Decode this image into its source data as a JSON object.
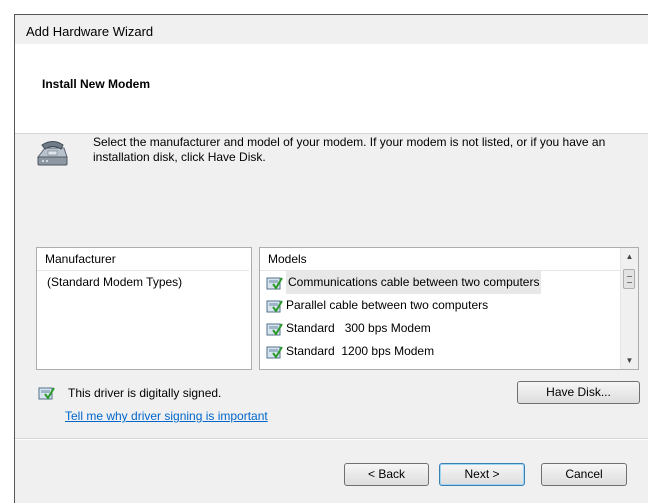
{
  "window": {
    "title": "Add Hardware Wizard"
  },
  "header": {
    "title": "Install New Modem"
  },
  "description": "Select the manufacturer and model of your modem. If your modem is not listed, or if you have an installation disk, click Have Disk.",
  "manufacturer_list": {
    "header": "Manufacturer",
    "items": [
      "(Standard Modem Types)"
    ]
  },
  "models_list": {
    "header": "Models",
    "items": [
      "Communications cable between two computers",
      "Parallel cable between two computers",
      "Standard   300 bps Modem",
      "Standard  1200 bps Modem"
    ],
    "selected_index": 0
  },
  "signing": {
    "status_text": "This driver is digitally signed.",
    "link_text": "Tell me why driver signing is important"
  },
  "buttons": {
    "have_disk": "Have Disk...",
    "back": "< Back",
    "next": "Next >",
    "cancel": "Cancel"
  },
  "colors": {
    "link": "#0066cc",
    "dialog_bg": "#f0f0f0",
    "selection": "#e8e8e8"
  }
}
